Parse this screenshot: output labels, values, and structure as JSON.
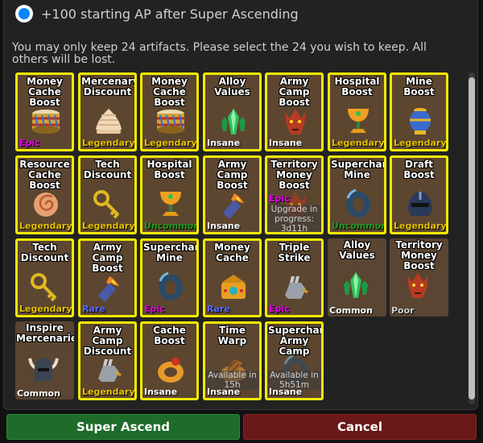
{
  "option": {
    "label": "+100 starting AP after Super Ascending",
    "selected": true
  },
  "instructions": "You may only keep 24 artifacts.  Please select the 24 you wish to keep.  All others will be lost.",
  "rarity_colors": {
    "Legendary": "#e6c300",
    "Epic": "#e000e0",
    "Insane": "#ffffff",
    "Uncommon": "#1e9b1e",
    "Rare": "#5b6bff",
    "Common": "#ffffff",
    "Poor": "#cfcfcf"
  },
  "artifacts": [
    {
      "name": "Money Cache Boost",
      "rarity": "Epic",
      "icon": "drum-icon",
      "selected": true
    },
    {
      "name": "Mercenary Discount",
      "rarity": "Legendary",
      "icon": "swirl-shell-icon",
      "selected": true
    },
    {
      "name": "Money Cache Boost",
      "rarity": "Legendary",
      "icon": "drum-icon",
      "selected": true
    },
    {
      "name": "Alloy Values",
      "rarity": "Insane",
      "icon": "crystal-icon",
      "selected": true
    },
    {
      "name": "Army Camp Boost",
      "rarity": "Insane",
      "icon": "dragon-head-icon",
      "selected": true
    },
    {
      "name": "Hospital Boost",
      "rarity": "Legendary",
      "icon": "chalice-icon",
      "selected": true
    },
    {
      "name": "Mine Boost",
      "rarity": "Legendary",
      "icon": "vase-icon",
      "selected": true
    },
    {
      "name": "Resource Cache Boost",
      "rarity": "Legendary",
      "icon": "shell-icon",
      "selected": true
    },
    {
      "name": "Tech Discount",
      "rarity": "Legendary",
      "icon": "key-icon",
      "selected": true
    },
    {
      "name": "Hospital Boost",
      "rarity": "Uncommon",
      "icon": "chalice-icon",
      "selected": true
    },
    {
      "name": "Army Camp Boost",
      "rarity": "Insane",
      "icon": "fire-hammer-icon",
      "selected": true
    },
    {
      "name": "Territory Money Boost",
      "rarity": "Epic",
      "icon": "dragon-head-icon",
      "selected": true,
      "note": "Upgrade in progress: 3d11h"
    },
    {
      "name": "Supercharge Mine",
      "rarity": "Uncommon",
      "icon": "ring-icon",
      "selected": true
    },
    {
      "name": "Draft Boost",
      "rarity": "Legendary",
      "icon": "helmet-icon",
      "selected": true
    },
    {
      "name": "Tech Discount",
      "rarity": "Legendary",
      "icon": "key-icon",
      "selected": true
    },
    {
      "name": "Army Camp Boost",
      "rarity": "Rare",
      "icon": "fire-hammer-icon",
      "selected": true
    },
    {
      "name": "Supercharge Mine",
      "rarity": "Epic",
      "icon": "ring-icon",
      "selected": true
    },
    {
      "name": "Money Cache",
      "rarity": "Rare",
      "icon": "jewel-box-icon",
      "selected": true
    },
    {
      "name": "Triple Strike",
      "rarity": "Epic",
      "icon": "gauntlet-icon",
      "selected": true
    },
    {
      "name": "Alloy Values",
      "rarity": "Common",
      "icon": "crystal-icon",
      "selected": false
    },
    {
      "name": "Territory Money Boost",
      "rarity": "Poor",
      "icon": "dragon-head-icon",
      "selected": false
    },
    {
      "name": "Inspire Mercenaries",
      "rarity": "Common",
      "icon": "horned-helmet-icon",
      "selected": false
    },
    {
      "name": "Army Camp Discount",
      "rarity": "Legendary",
      "icon": "gauntlet-icon",
      "selected": true
    },
    {
      "name": "Cache Boost",
      "rarity": "Insane",
      "icon": "ring-gold-icon",
      "selected": true
    },
    {
      "name": "Time Warp",
      "rarity": "Insane",
      "icon": "hourglass-icon",
      "selected": true,
      "note": "Available in 15h"
    },
    {
      "name": "Supercharge Army Camp",
      "rarity": "Insane",
      "icon": "ring-icon",
      "selected": true,
      "note": "Available in 5h51m"
    }
  ],
  "buttons": {
    "ascend": "Super Ascend",
    "cancel": "Cancel"
  }
}
